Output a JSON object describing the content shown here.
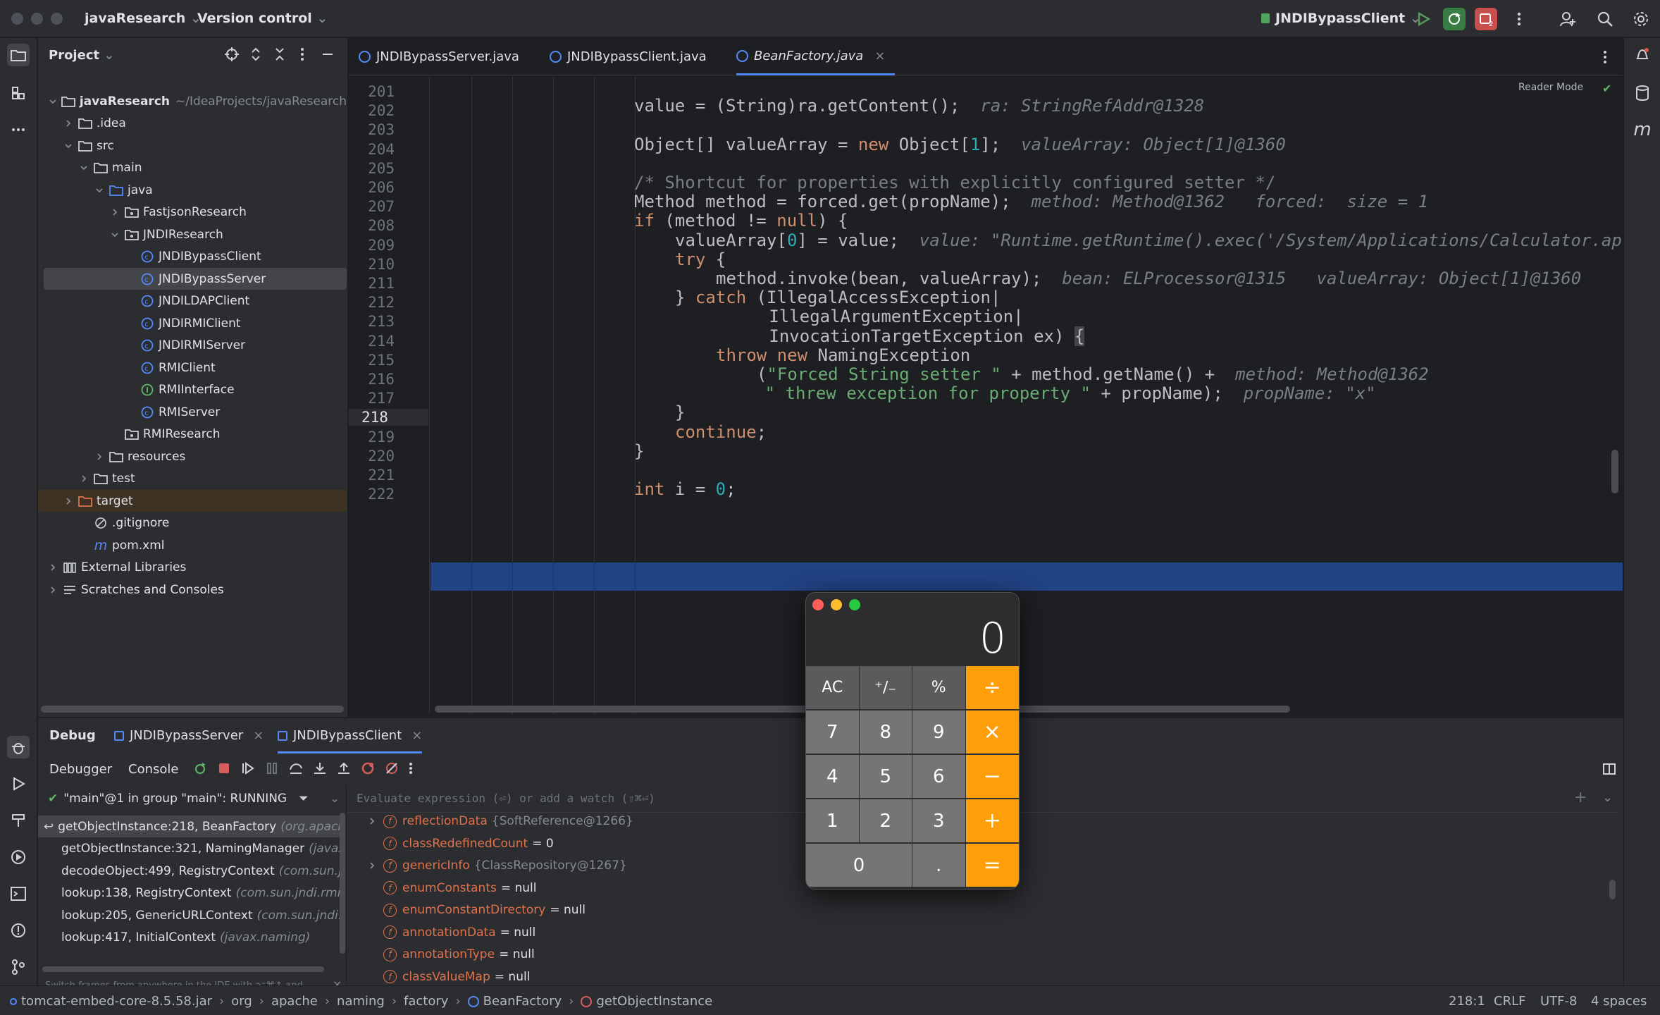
{
  "titlebar": {
    "project_name": "javaResearch",
    "vcs": "Version control",
    "run_config": "JNDIBypassClient"
  },
  "project": {
    "header": "Project",
    "tree": [
      {
        "label": "javaResearch",
        "extra": "~/IdeaProjects/javaResearch",
        "depth": 0,
        "open": true,
        "kind": "module"
      },
      {
        "label": ".idea",
        "depth": 1,
        "open": false,
        "kind": "folder"
      },
      {
        "label": "src",
        "depth": 1,
        "open": true,
        "kind": "folder"
      },
      {
        "label": "main",
        "depth": 2,
        "open": true,
        "kind": "folder"
      },
      {
        "label": "java",
        "depth": 3,
        "open": true,
        "kind": "src"
      },
      {
        "label": "FastjsonResearch",
        "depth": 4,
        "open": false,
        "kind": "package"
      },
      {
        "label": "JNDIResearch",
        "depth": 4,
        "open": true,
        "kind": "package"
      },
      {
        "label": "JNDIBypassClient",
        "depth": 5,
        "kind": "class"
      },
      {
        "label": "JNDIBypassServer",
        "depth": 5,
        "kind": "class",
        "selected": true
      },
      {
        "label": "JNDILDAPClient",
        "depth": 5,
        "kind": "class"
      },
      {
        "label": "JNDIRMIClient",
        "depth": 5,
        "kind": "class"
      },
      {
        "label": "JNDIRMIServer",
        "depth": 5,
        "kind": "class"
      },
      {
        "label": "RMIClient",
        "depth": 5,
        "kind": "class"
      },
      {
        "label": "RMIInterface",
        "depth": 5,
        "kind": "interface"
      },
      {
        "label": "RMIServer",
        "depth": 5,
        "kind": "class"
      },
      {
        "label": "RMIResearch",
        "depth": 4,
        "kind": "package"
      },
      {
        "label": "resources",
        "depth": 3,
        "open": false,
        "kind": "res"
      },
      {
        "label": "test",
        "depth": 2,
        "open": false,
        "kind": "folder"
      },
      {
        "label": "target",
        "depth": 1,
        "open": false,
        "kind": "excluded",
        "highlight": true
      },
      {
        "label": ".gitignore",
        "depth": 2,
        "kind": "ignore"
      },
      {
        "label": "pom.xml",
        "depth": 2,
        "kind": "maven"
      },
      {
        "label": "External Libraries",
        "depth": 0,
        "open": false,
        "kind": "lib"
      },
      {
        "label": "Scratches and Consoles",
        "depth": 0,
        "open": false,
        "kind": "scratch"
      }
    ]
  },
  "editor": {
    "tabs": [
      {
        "label": "JNDIBypassServer.java",
        "active": false
      },
      {
        "label": "JNDIBypassClient.java",
        "active": false
      },
      {
        "label": "BeanFactory.java",
        "active": true
      }
    ],
    "reader_mode": "Reader Mode",
    "lines": [
      {
        "n": "201",
        "indent": 0,
        "html": ""
      },
      {
        "n": "202",
        "indent": 5,
        "html": "value = (String)ra.getContent();  <span class=\"hint\">ra: StringRefAddr@1328</span>"
      },
      {
        "n": "203",
        "indent": 0,
        "html": ""
      },
      {
        "n": "204",
        "indent": 5,
        "html": "Object[] valueArray = <span class=\"kw\">new</span> Object[<span class=\"num\">1</span>];  <span class=\"hint\">valueArray: Object[1]@1360</span>"
      },
      {
        "n": "205",
        "indent": 0,
        "html": ""
      },
      {
        "n": "206",
        "indent": 5,
        "html": "<span class=\"cm\" style=\"font-style:normal\">/* Shortcut for properties with explicitly configured setter */</span>"
      },
      {
        "n": "207",
        "indent": 5,
        "html": "Method method = forced.get(propName);  <span class=\"hint\">method: Method@1362   forced:  size = 1</span>"
      },
      {
        "n": "208",
        "indent": 5,
        "html": "<span class=\"kw\">if</span> (method != <span class=\"kw\">null</span>) {"
      },
      {
        "n": "209",
        "indent": 6,
        "html": "valueArray[<span class=\"num\">0</span>] = value;  <span class=\"hint\">value: \"Runtime.getRuntime().exec('/System/Applications/Calculator.ap</span>"
      },
      {
        "n": "210",
        "indent": 6,
        "html": "<span class=\"kw\">try</span> {"
      },
      {
        "n": "211",
        "indent": 7,
        "html": "method.invoke(bean, valueArray);  <span class=\"hint\">bean: ELProcessor@1315   valueArray: Object[1]@1360</span>"
      },
      {
        "n": "212",
        "indent": 6,
        "html": "} <span class=\"kw\">catch</span> (IllegalAccessException|"
      },
      {
        "n": "213",
        "indent": 8.3,
        "html": "IllegalArgumentException|"
      },
      {
        "n": "214",
        "indent": 8.3,
        "html": "InvocationTargetException ex) <span style=\"background:#43454a\">{</span>"
      },
      {
        "n": "215",
        "indent": 7,
        "html": "<span class=\"kw\">throw new</span> NamingException"
      },
      {
        "n": "216",
        "indent": 8,
        "html": "(<span class=\"str\">\"Forced String setter \"</span> + method.getName() +  <span class=\"hint\">method: Method@1362</span>"
      },
      {
        "n": "217",
        "indent": 8.2,
        "html": "<span class=\"str\">\" threw exception for property \"</span> + propName);  <span class=\"hint\">propName: \"x\"</span>"
      },
      {
        "n": "218",
        "indent": 6,
        "html": "}"
      },
      {
        "n": "219",
        "indent": 6,
        "html": "<span class=\"kw\">continue</span>;"
      },
      {
        "n": "220",
        "indent": 5,
        "html": "}"
      },
      {
        "n": "221",
        "indent": 0,
        "html": ""
      },
      {
        "n": "222",
        "indent": 5,
        "html": "<span class=\"kw\">int</span> i = <span class=\"num\">0</span>;"
      }
    ]
  },
  "debug": {
    "title": "Debug",
    "sessions": [
      "JNDIBypassServer",
      "JNDIBypassClient"
    ],
    "tabs": [
      "Debugger",
      "Console"
    ],
    "thread": "\"main\"@1 in group \"main\": RUNNING",
    "watch_placeholder": "Evaluate expression (⏎) or add a watch (⇧⌘⏎)",
    "frames": [
      {
        "method": "getObjectInstance:218, BeanFactory",
        "pkg": "(org.apach",
        "current": true
      },
      {
        "method": "getObjectInstance:321, NamingManager",
        "pkg": "(javax.r"
      },
      {
        "method": "decodeObject:499, RegistryContext",
        "pkg": "(com.sun.jn"
      },
      {
        "method": "lookup:138, RegistryContext",
        "pkg": "(com.sun.jndi.rmi.re"
      },
      {
        "method": "lookup:205, GenericURLContext",
        "pkg": "(com.sun.jndi.tc"
      },
      {
        "method": "lookup:417, InitialContext",
        "pkg": "(javax.naming)"
      }
    ],
    "frames_hint": "Switch frames from anywhere in the IDE with ⌥⌘↑ and ...",
    "variables": [
      {
        "name": "reflectionData",
        "value": "{SoftReference@1266}",
        "expandable": true,
        "muted": true
      },
      {
        "name": "classRedefinedCount",
        "value": "= 0"
      },
      {
        "name": "genericInfo",
        "value": "{ClassRepository@1267}",
        "expandable": true,
        "muted": true
      },
      {
        "name": "enumConstants",
        "value": "= null"
      },
      {
        "name": "enumConstantDirectory",
        "value": "= null"
      },
      {
        "name": "annotationData",
        "value": "= null"
      },
      {
        "name": "annotationType",
        "value": "= null"
      },
      {
        "name": "classValueMap",
        "value": "= null"
      }
    ]
  },
  "statusbar": {
    "breadcrumbs": [
      "tomcat-embed-core-8.5.58.jar",
      "org",
      "apache",
      "naming",
      "factory",
      "BeanFactory",
      "getObjectInstance"
    ],
    "position": "218:1",
    "line_sep": "CRLF",
    "encoding": "UTF-8",
    "indent": "4 spaces"
  },
  "calculator": {
    "display": "0",
    "keys": [
      [
        "AC",
        "⁺∕₋",
        "%",
        "÷"
      ],
      [
        "7",
        "8",
        "9",
        "×"
      ],
      [
        "4",
        "5",
        "6",
        "−"
      ],
      [
        "1",
        "2",
        "3",
        "+"
      ],
      [
        "0",
        ".",
        "="
      ]
    ]
  },
  "colors": {
    "accent": "#548af7",
    "highlight": "#214283",
    "calc_op": "#fe9f0a"
  }
}
